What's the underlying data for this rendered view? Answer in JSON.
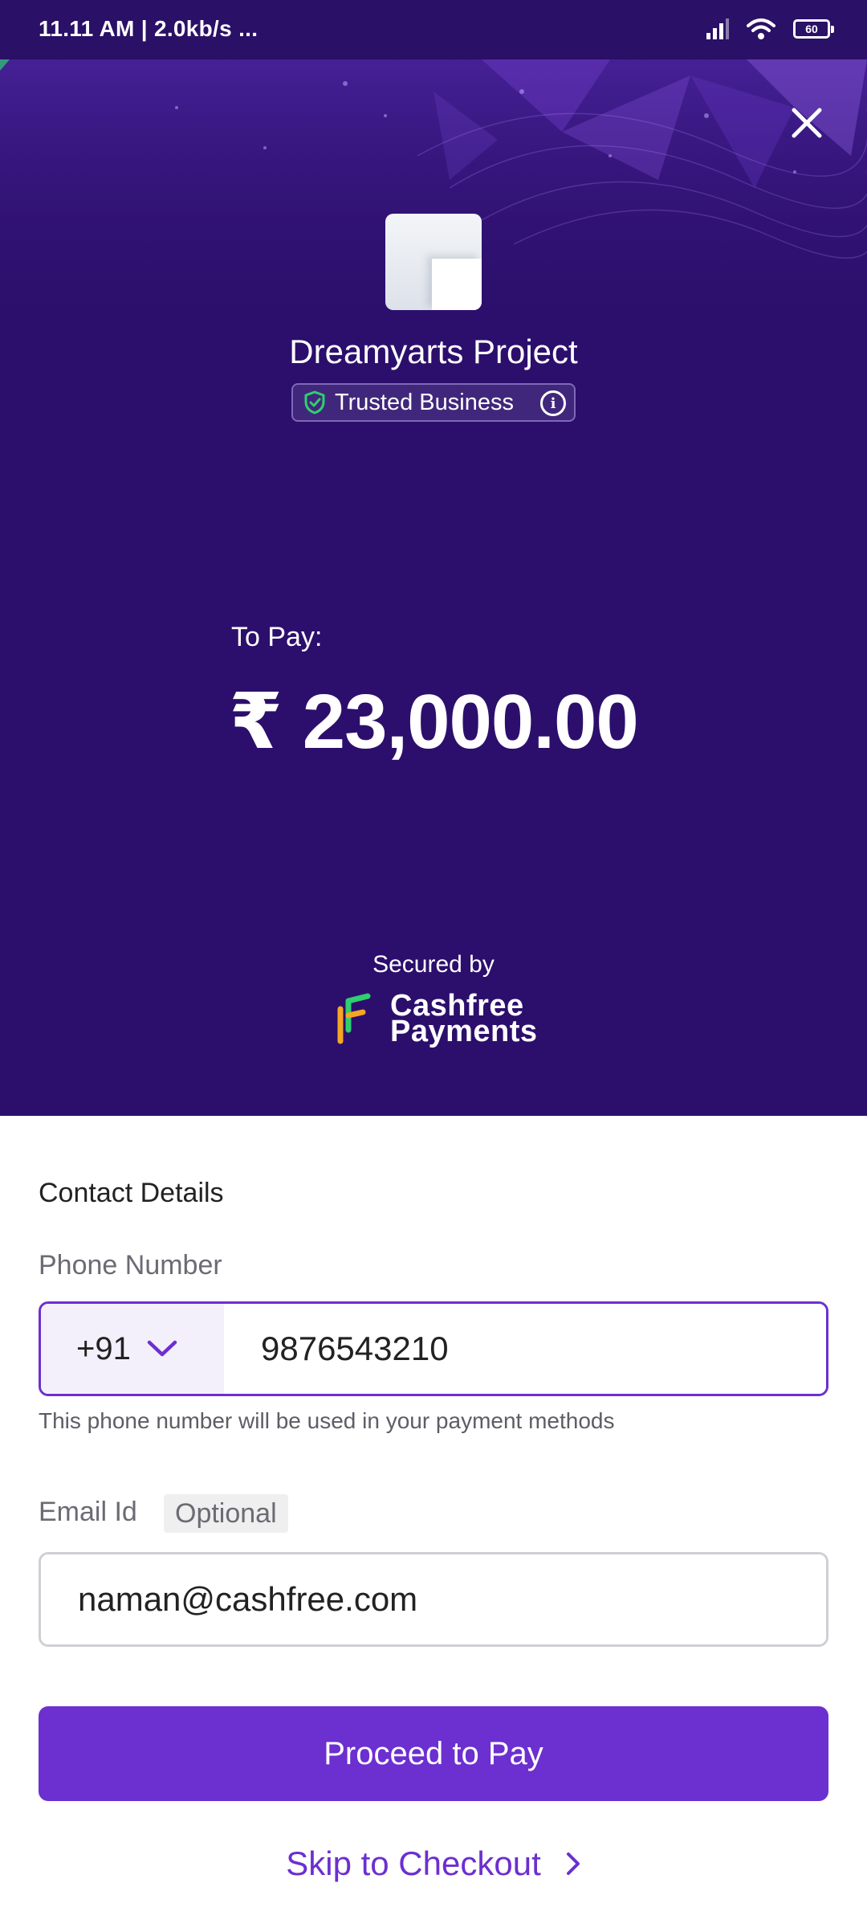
{
  "status_bar": {
    "time_speed": "11.11 AM | 2.0kb/s ...",
    "battery": "60",
    "icons": [
      "signal-icon",
      "wifi-icon",
      "battery-icon"
    ]
  },
  "header": {
    "background_color": "#2c0f6c",
    "close_icon": "close-icon",
    "merchant_logo_icon": "merchant-logo",
    "merchant_name": "Dreamyarts Project",
    "trusted_label": "Trusted Business",
    "trusted_icon": "shield-check-icon",
    "info_icon": "info-icon"
  },
  "payment": {
    "to_pay_label": "To Pay:",
    "amount": "₹ 23,000.00"
  },
  "security": {
    "secured_by": "Secured by",
    "brand_line1": "Cashfree",
    "brand_line2": "Payments"
  },
  "form": {
    "section_title": "Contact Details",
    "phone_label": "Phone Number",
    "country_code": "+91",
    "phone_value": "9876543210",
    "phone_helper": "This phone number will be used in your payment methods",
    "email_label": "Email Id",
    "email_optional": "Optional",
    "email_value": "naman@cashfree.com"
  },
  "actions": {
    "proceed_label": "Proceed to Pay",
    "skip_label": "Skip to Checkout"
  },
  "colors": {
    "accent": "#6c2fd0",
    "header_bg": "#2c0f6c",
    "trusted_green": "#2fcf6f"
  }
}
